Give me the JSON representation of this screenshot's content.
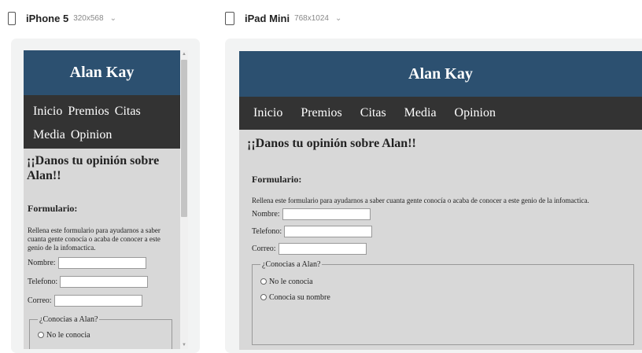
{
  "devices": [
    {
      "name": "iPhone 5",
      "size": "320x568",
      "chevron": "⌄"
    },
    {
      "name": "iPad Mini",
      "size": "768x1024",
      "chevron": "⌄"
    }
  ],
  "site": {
    "title": "Alan Kay",
    "nav": [
      "Inicio",
      "Premios",
      "Citas",
      "Media",
      "Opinion"
    ],
    "heading": "¡¡Danos tu opinión sobre Alan!!",
    "form_title": "Formulario:",
    "form_desc": "Rellena este formulario para ayudarnos a saber cuanta gente conocía o acaba de conocer a este genio de la infomactica.",
    "fields": [
      {
        "label": "Nombre:",
        "value": ""
      },
      {
        "label": "Telefono:",
        "value": ""
      },
      {
        "label": "Correo:",
        "value": ""
      }
    ],
    "fieldset_legend": "¿Conocias a Alan?",
    "radios": [
      "No le conocia",
      "Conocia su nombre"
    ]
  },
  "colors": {
    "header": "#2c5070",
    "nav": "#333333",
    "page_bg": "#d8d8d8"
  }
}
